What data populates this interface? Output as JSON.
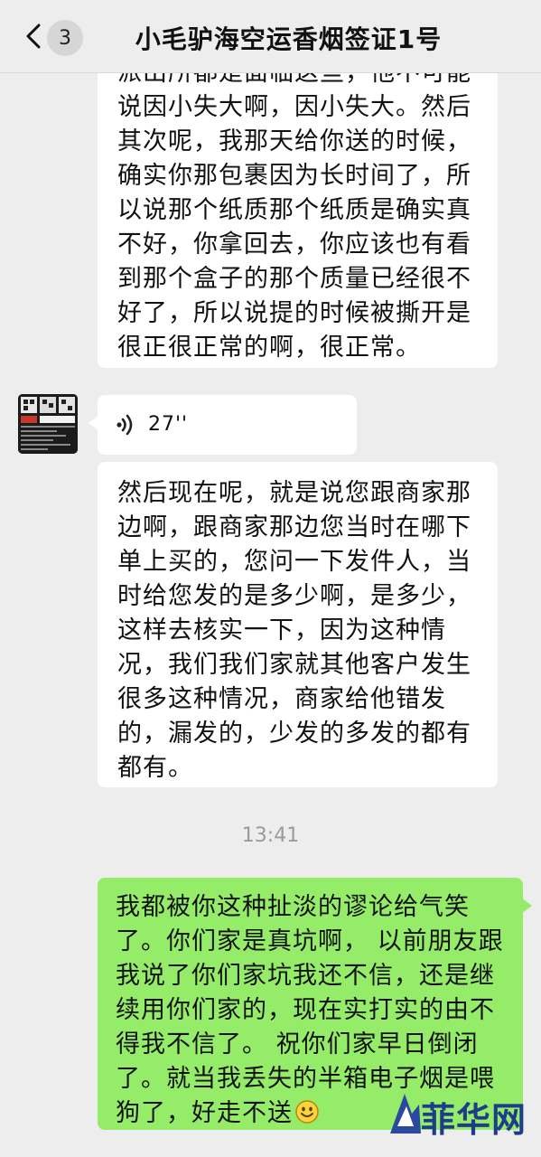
{
  "header": {
    "back_icon": "chevron-left-icon",
    "unread_count": "3",
    "title": "小毛驴海空运香烟签证1号"
  },
  "messages": [
    {
      "side": "left",
      "type": "text",
      "text": "派出所都是面临这些，他不可能说因小失大啊，因小失大。然后其次呢，我那天给你送的时候，确实你那包裹因为长时间了，所以说那个纸质那个纸质是确实真不好，你拿回去，你应该也有看到那个盒子的那个质量已经很不好了，所以说提的时候被撕开是很正很正常的啊，很正常。"
    },
    {
      "side": "left",
      "type": "voice",
      "icon": "voice-wave-icon",
      "duration": "27''"
    },
    {
      "side": "left",
      "type": "text",
      "text": "然后现在呢，就是说您跟商家那边啊，跟商家那边您当时在哪下单上买的，您问一下发件人，当时给您发的是多少啊，是多少，这样去核实一下，因为这种情况，我们我们家就其他客户发生很多这种情况，商家给他错发的，漏发的，少发的多发的都有都有。"
    },
    {
      "type": "timestamp",
      "text": "13:41"
    },
    {
      "side": "right",
      "type": "text",
      "text": "我都被你这种扯淡的谬论给气笑了。你们家是真坑啊，  以前朋友跟我说了你们家坑我还不信，还是继续用你们家的，现在实打实的由不得我不信了。 祝你们家早日倒闭了。就当我丢失的半箱电子烟是喂狗了，好走不送",
      "emoji": "smiley-icon"
    }
  ],
  "watermark": {
    "text": "菲华网"
  },
  "colors": {
    "background": "#ededed",
    "incoming_bubble": "#ffffff",
    "outgoing_bubble": "#95ec69",
    "watermark": "#1f3c8a"
  }
}
